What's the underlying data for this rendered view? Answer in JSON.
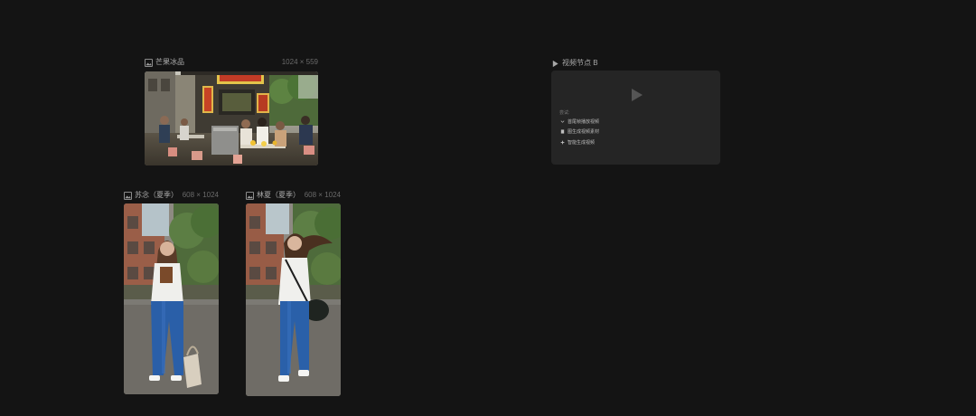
{
  "nodes": {
    "street": {
      "title": "芒果冰品",
      "dims": "1024 × 559"
    },
    "portrait1": {
      "title": "苏念（夏季）",
      "dims": "608 × 1024"
    },
    "portrait2": {
      "title": "林夏（夏季）",
      "dims": "608 × 1024"
    },
    "video": {
      "title": "视频节点 B",
      "section_label": "尝试:",
      "actions": [
        {
          "icon": "chevron-down-icon",
          "label": "首尾帧播放视频"
        },
        {
          "icon": "document-icon",
          "label": "图生成视频素材"
        },
        {
          "icon": "sparkle-icon",
          "label": "智能生成视频"
        }
      ]
    }
  },
  "colors": {
    "canvas_bg": "#141414",
    "card_bg": "#252525",
    "label": "#a8a8a8",
    "dims": "#6a6a6a"
  }
}
